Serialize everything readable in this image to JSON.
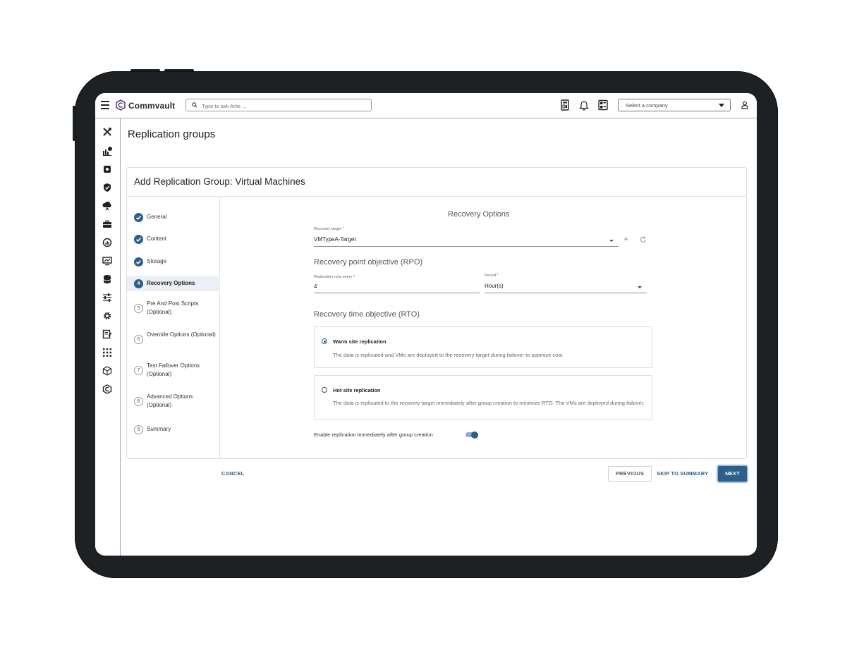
{
  "header": {
    "brand": "Commvault",
    "search_placeholder": "Type to ask Arlie ...",
    "company_select": "Select a company"
  },
  "page_title": "Replication groups",
  "card_title": "Add Replication Group: Virtual Machines",
  "steps": [
    {
      "num": "1",
      "label": "General",
      "state": "done"
    },
    {
      "num": "2",
      "label": "Content",
      "state": "done"
    },
    {
      "num": "3",
      "label": "Storage",
      "state": "done"
    },
    {
      "num": "4",
      "label": "Recovery Options",
      "state": "active"
    },
    {
      "num": "5",
      "label": "Pre And Post Scripts (Optional)",
      "state": "todo"
    },
    {
      "num": "6",
      "label": "Override Options (Optional)",
      "state": "todo"
    },
    {
      "num": "7",
      "label": "Test Failover Options (Optional)",
      "state": "todo"
    },
    {
      "num": "8",
      "label": "Advanced Options (Optional)",
      "state": "todo"
    },
    {
      "num": "9",
      "label": "Summary",
      "state": "todo"
    }
  ],
  "form": {
    "section_title": "Recovery Options",
    "recovery_target_label": "Recovery target *",
    "recovery_target_value": "VMTypeA-Target",
    "rpo_title": "Recovery point objective (RPO)",
    "replication_runs_label": "Replication runs every *",
    "replication_runs_value": "4",
    "period_label": "Period *",
    "period_value": "Hour(s)",
    "rto_title": "Recovery time objective (RTO)",
    "warm_title": "Warm site replication",
    "warm_desc": "The data is replicated and VMs are deployed to the recovery target during failover to optimize cost.",
    "hot_title": "Hot site replication",
    "hot_desc": "The data is replicated to the recovery target immediately after group creation to minimize RTO. The VMs are deployed during failover.",
    "enable_label": "Enable replication immediately after group creation",
    "enable_on": true,
    "selected_rto": "warm"
  },
  "buttons": {
    "cancel": "CANCEL",
    "previous": "PREVIOUS",
    "skip": "SKIP TO SUMMARY",
    "next": "NEXT"
  },
  "colors": {
    "accent": "#2d5f8a",
    "frame": "#1d2123",
    "divider_purple": "#b89ac0"
  }
}
